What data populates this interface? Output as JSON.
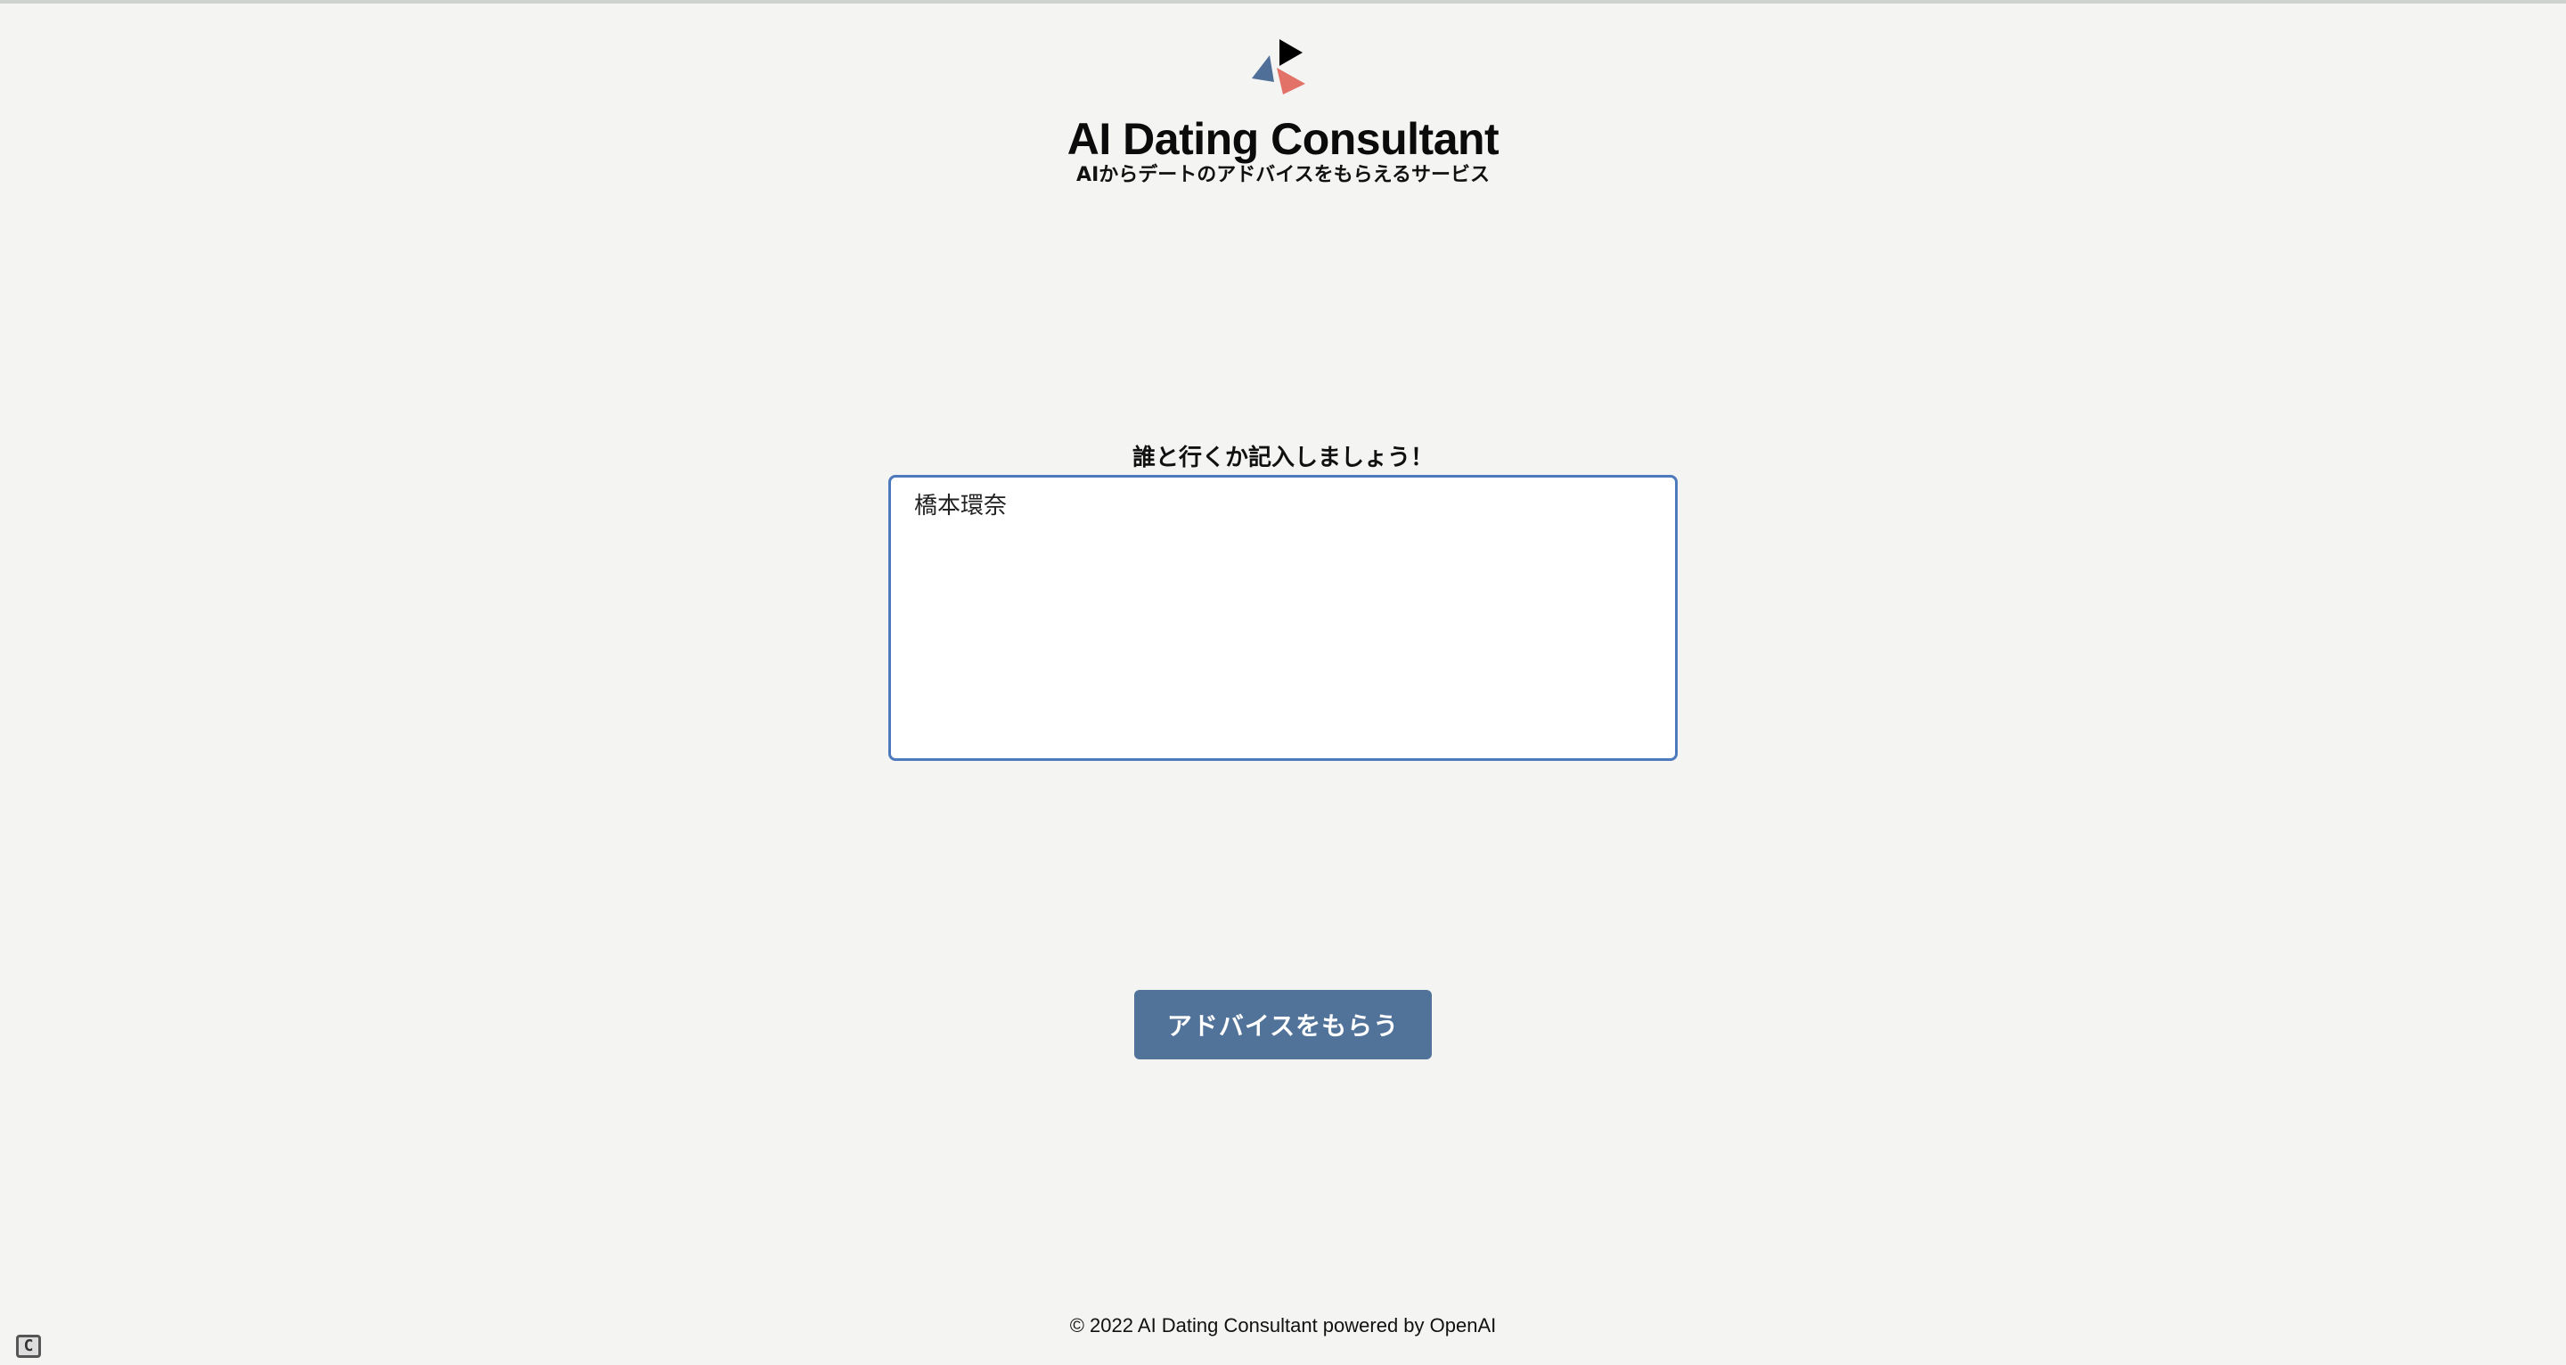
{
  "header": {
    "logo_icon": "triangle-play-logo-icon",
    "title": "AI Dating Consultant",
    "subtitle": "AIからデートのアドバイスをもらえるサービス"
  },
  "form": {
    "label": "誰と行くか記入しましょう！",
    "input_value": "橋本環奈",
    "submit_label": "アドバイスをもらう"
  },
  "footer": {
    "text": "© 2022 AI Dating Consultant powered by OpenAI"
  },
  "corner_badge": {
    "icon": "c-badge-icon",
    "text": "C"
  },
  "colors": {
    "background": "#f4f5f3",
    "button": "#527399",
    "textarea_border": "#4d79bd",
    "logo_black": "#000000",
    "logo_blue": "#4f6f98",
    "logo_red": "#e27168"
  }
}
